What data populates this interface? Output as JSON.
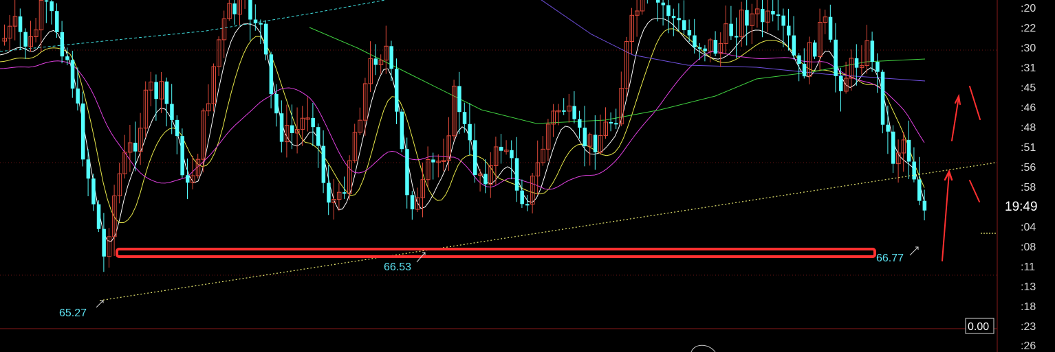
{
  "chart_data": {
    "type": "candlestick",
    "time_axis_labels": [
      ":20",
      ":22",
      ":30",
      ":31",
      ":45",
      ":46",
      ":48",
      ":51",
      ":56",
      ":58",
      "19:49",
      ":04",
      ":08",
      ":11",
      ":13",
      ":18",
      ":23",
      ":26"
    ],
    "current_time": "19:49",
    "bottom_readout": "0.00",
    "price_annotations": [
      "65.27",
      "66.53",
      "66.77"
    ],
    "colors": {
      "up_candle": "#e04a3a",
      "down_candle": "#54ffff",
      "support_box": "#ff3030",
      "trendline": "#e8e870",
      "ma_white": "#ffffff",
      "ma_yellow": "#e8e84a",
      "ma_magenta": "#e040e0",
      "ma_green": "#40d040",
      "ma_purple": "#7050e0",
      "ma_cyan_dashed": "#40e0e0",
      "arrows": "#ff3030",
      "axis_text": "#d6d6d6"
    }
  }
}
